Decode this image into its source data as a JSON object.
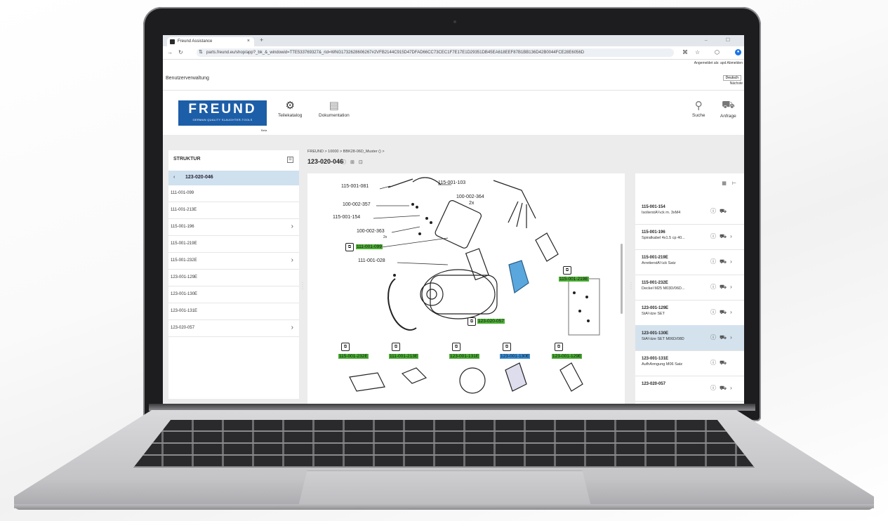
{
  "browser": {
    "tab_title": "Freund Assistance",
    "tab_close": "×",
    "new_tab": "+",
    "url": "parts.freund.eu/shop/app?_bk_&_windowid=TTE53376932​7&_rid=WNG1732628606267#2VFB2144C915D47DFAD66CC73CEC1F7E17E1D29351DB45EA618EEF87B1BB136D42B0044FCE28E6056D",
    "window_controls": "– ☐"
  },
  "app": {
    "admin_link": "Benutzerverwaltung",
    "logged_in": "Angemeldet als: apd Abmelden",
    "language": "Deutsch",
    "next_label": "Nächste",
    "logo_brand": "FREUND",
    "logo_sub": "GERMAN QUALITY SLAUGHTER-TOOLS",
    "beta": "Beta",
    "menu": {
      "catalog": "Teilekatalog",
      "docs": "Dokumentation",
      "search": "Suche",
      "request": "Anfrage"
    }
  },
  "structure": {
    "title": "STRUKTUR",
    "current": "123-020-046",
    "items": [
      {
        "label": "111-001-099",
        "has_children": false
      },
      {
        "label": "111-001-213E",
        "has_children": false
      },
      {
        "label": "115-001-196",
        "has_children": true
      },
      {
        "label": "115-001-219E",
        "has_children": false
      },
      {
        "label": "115-001-232E",
        "has_children": true
      },
      {
        "label": "123-001-129E",
        "has_children": false
      },
      {
        "label": "123-001-130E",
        "has_children": false
      },
      {
        "label": "123-001-131E",
        "has_children": false
      },
      {
        "label": "123-020-057",
        "has_children": true
      }
    ]
  },
  "breadcrumb": "FREUND > 10000 > BBK28-06D_Muster () >",
  "page_title": "123-020-046",
  "drawing": {
    "labels": [
      "115-001-081",
      "115-001-103",
      "100-002-357",
      "100-002-364",
      "2x",
      "115-001-154",
      "100-002-363",
      "2x",
      "111-001-028"
    ],
    "green_callouts": [
      "111-001-099",
      "115-001-219E",
      "123-020-057",
      "115-001-232E",
      "111-001-213E",
      "123-001-131E",
      "123-001-129E"
    ],
    "blue_callouts": [
      "123-001-130E"
    ]
  },
  "parts_list": [
    {
      "code": "115-001-154",
      "desc": "IsolierstÃ¼ck m. 3xM4",
      "selected": false
    },
    {
      "code": "115-001-196",
      "desc": "Spiralkabel 4x1.5 cp 40...",
      "selected": false
    },
    {
      "code": "115-001-219E",
      "desc": "ArretierstÃ¼ck Satz",
      "selected": false
    },
    {
      "code": "115-001-232E",
      "desc": "Deckel M25 M03D/06D...",
      "selected": false
    },
    {
      "code": "123-001-129E",
      "desc": "StÃ¼tze SET",
      "selected": false
    },
    {
      "code": "123-001-130E",
      "desc": "StÃ¼tze SET M06D/08D",
      "selected": true
    },
    {
      "code": "123-001-131E",
      "desc": "AufhÃ¤ngung M06 Satz",
      "selected": false
    },
    {
      "code": "123-020-057",
      "desc": "",
      "selected": false
    }
  ]
}
